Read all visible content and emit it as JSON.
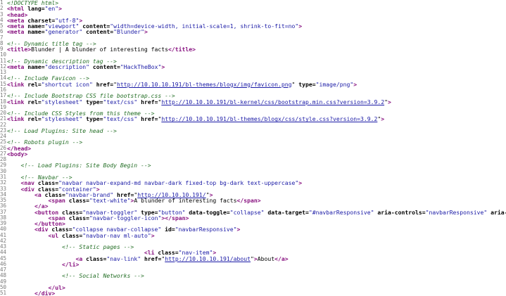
{
  "source_lines": [
    {
      "n": "1",
      "indent": "",
      "tokens": [
        {
          "t": "c",
          "v": "<!DOCTYPE html>"
        }
      ]
    },
    {
      "n": "2",
      "indent": "",
      "tokens": [
        {
          "t": "tag",
          "v": "<html"
        },
        {
          "t": "attr",
          "v": " lang="
        },
        {
          "t": "val",
          "v": "\"en\""
        },
        {
          "t": "tag",
          "v": ">"
        }
      ]
    },
    {
      "n": "3",
      "indent": "",
      "tokens": [
        {
          "t": "tag",
          "v": "<head>"
        }
      ]
    },
    {
      "n": "4",
      "indent": "",
      "tokens": [
        {
          "t": "tag",
          "v": "<meta"
        },
        {
          "t": "attr",
          "v": " charset="
        },
        {
          "t": "val",
          "v": "\"utf-8\""
        },
        {
          "t": "tag",
          "v": ">"
        }
      ]
    },
    {
      "n": "5",
      "indent": "",
      "tokens": [
        {
          "t": "tag",
          "v": "<meta"
        },
        {
          "t": "attr",
          "v": " name="
        },
        {
          "t": "val",
          "v": "\"viewport\""
        },
        {
          "t": "attr",
          "v": " content="
        },
        {
          "t": "val",
          "v": "\"width=device-width, initial-scale=1, shrink-to-fit=no\""
        },
        {
          "t": "tag",
          "v": ">"
        }
      ]
    },
    {
      "n": "6",
      "indent": "",
      "tokens": [
        {
          "t": "tag",
          "v": "<meta"
        },
        {
          "t": "attr",
          "v": " name="
        },
        {
          "t": "val",
          "v": "\"generator\""
        },
        {
          "t": "attr",
          "v": " content="
        },
        {
          "t": "val",
          "v": "\"Blunder\""
        },
        {
          "t": "tag",
          "v": ">"
        }
      ]
    },
    {
      "n": "7",
      "indent": "",
      "tokens": []
    },
    {
      "n": "8",
      "indent": "",
      "tokens": [
        {
          "t": "c",
          "v": "<!-- Dynamic title tag -->"
        }
      ]
    },
    {
      "n": "9",
      "indent": "",
      "tokens": [
        {
          "t": "tag",
          "v": "<title>"
        },
        {
          "t": "txt",
          "v": "Blunder | A blunder of interesting facts"
        },
        {
          "t": "tag",
          "v": "</title>"
        }
      ]
    },
    {
      "n": "10",
      "indent": "",
      "tokens": []
    },
    {
      "n": "11",
      "indent": "",
      "tokens": [
        {
          "t": "c",
          "v": "<!-- Dynamic description tag -->"
        }
      ]
    },
    {
      "n": "12",
      "indent": "",
      "tokens": [
        {
          "t": "tag",
          "v": "<meta"
        },
        {
          "t": "attr",
          "v": " name="
        },
        {
          "t": "val",
          "v": "\"description\""
        },
        {
          "t": "attr",
          "v": " content="
        },
        {
          "t": "val",
          "v": "\"HackTheBox\""
        },
        {
          "t": "tag",
          "v": ">"
        }
      ]
    },
    {
      "n": "13",
      "indent": "",
      "tokens": []
    },
    {
      "n": "14",
      "indent": "",
      "tokens": [
        {
          "t": "c",
          "v": "<!-- Include Favicon -->"
        }
      ]
    },
    {
      "n": "15",
      "indent": "",
      "tokens": [
        {
          "t": "tag",
          "v": "<link"
        },
        {
          "t": "attr",
          "v": " rel="
        },
        {
          "t": "val",
          "v": "\"shortcut icon\""
        },
        {
          "t": "attr",
          "v": " href="
        },
        {
          "t": "txt",
          "v": "\""
        },
        {
          "t": "link",
          "v": "http://10.10.10.191/bl-themes/blogx/img/favicon.png"
        },
        {
          "t": "txt",
          "v": "\""
        },
        {
          "t": "attr",
          "v": " type="
        },
        {
          "t": "val",
          "v": "\"image/png\""
        },
        {
          "t": "tag",
          "v": ">"
        }
      ]
    },
    {
      "n": "16",
      "indent": "",
      "tokens": []
    },
    {
      "n": "17",
      "indent": "",
      "tokens": [
        {
          "t": "c",
          "v": "<!-- Include Bootstrap CSS file bootstrap.css -->"
        }
      ]
    },
    {
      "n": "18",
      "indent": "",
      "tokens": [
        {
          "t": "tag",
          "v": "<link"
        },
        {
          "t": "attr",
          "v": " rel="
        },
        {
          "t": "val",
          "v": "\"stylesheet\""
        },
        {
          "t": "attr",
          "v": " type="
        },
        {
          "t": "val",
          "v": "\"text/css\""
        },
        {
          "t": "attr",
          "v": " href="
        },
        {
          "t": "txt",
          "v": "\""
        },
        {
          "t": "link",
          "v": "http://10.10.10.191/bl-kernel/css/bootstrap.min.css?version=3.9.2"
        },
        {
          "t": "txt",
          "v": "\""
        },
        {
          "t": "tag",
          "v": ">"
        }
      ]
    },
    {
      "n": "19",
      "indent": "",
      "tokens": []
    },
    {
      "n": "20",
      "indent": "",
      "tokens": [
        {
          "t": "c",
          "v": "<!-- Include CSS Styles from this theme -->"
        }
      ]
    },
    {
      "n": "21",
      "indent": "",
      "tokens": [
        {
          "t": "tag",
          "v": "<link"
        },
        {
          "t": "attr",
          "v": " rel="
        },
        {
          "t": "val",
          "v": "\"stylesheet\""
        },
        {
          "t": "attr",
          "v": " type="
        },
        {
          "t": "val",
          "v": "\"text/css\""
        },
        {
          "t": "attr",
          "v": " href="
        },
        {
          "t": "txt",
          "v": "\""
        },
        {
          "t": "link",
          "v": "http://10.10.10.191/bl-themes/blogx/css/style.css?version=3.9.2"
        },
        {
          "t": "txt",
          "v": "\""
        },
        {
          "t": "tag",
          "v": ">"
        }
      ]
    },
    {
      "n": "22",
      "indent": "",
      "tokens": []
    },
    {
      "n": "23",
      "indent": "",
      "tokens": [
        {
          "t": "c",
          "v": "<!-- Load Plugins: Site head -->"
        }
      ]
    },
    {
      "n": "24",
      "indent": "",
      "tokens": []
    },
    {
      "n": "25",
      "indent": "",
      "tokens": [
        {
          "t": "c",
          "v": "<!-- Robots plugin -->"
        }
      ]
    },
    {
      "n": "26",
      "indent": "",
      "tokens": [
        {
          "t": "tag",
          "v": "</head>"
        }
      ]
    },
    {
      "n": "27",
      "indent": "",
      "tokens": [
        {
          "t": "tag",
          "v": "<body>"
        }
      ]
    },
    {
      "n": "28",
      "indent": "",
      "tokens": []
    },
    {
      "n": "29",
      "indent": "    ",
      "tokens": [
        {
          "t": "c",
          "v": "<!-- Load Plugins: Site Body Begin -->"
        }
      ]
    },
    {
      "n": "30",
      "indent": "",
      "tokens": []
    },
    {
      "n": "31",
      "indent": "    ",
      "tokens": [
        {
          "t": "c",
          "v": "<!-- Navbar -->"
        }
      ]
    },
    {
      "n": "32",
      "indent": "    ",
      "tokens": [
        {
          "t": "tag",
          "v": "<nav"
        },
        {
          "t": "attr",
          "v": " class="
        },
        {
          "t": "val",
          "v": "\"navbar navbar-expand-md navbar-dark fixed-top bg-dark text-uppercase\""
        },
        {
          "t": "tag",
          "v": ">"
        }
      ]
    },
    {
      "n": "33",
      "indent": "    ",
      "tokens": [
        {
          "t": "tag",
          "v": "<div"
        },
        {
          "t": "attr",
          "v": " class="
        },
        {
          "t": "val",
          "v": "\"container\""
        },
        {
          "t": "tag",
          "v": ">"
        }
      ]
    },
    {
      "n": "34",
      "indent": "        ",
      "tokens": [
        {
          "t": "tag",
          "v": "<a"
        },
        {
          "t": "attr",
          "v": " class="
        },
        {
          "t": "val",
          "v": "\"navbar-brand\""
        },
        {
          "t": "attr",
          "v": " href="
        },
        {
          "t": "txt",
          "v": "\""
        },
        {
          "t": "link",
          "v": "http://10.10.10.191/"
        },
        {
          "t": "txt",
          "v": "\""
        },
        {
          "t": "tag",
          "v": ">"
        }
      ]
    },
    {
      "n": "35",
      "indent": "            ",
      "tokens": [
        {
          "t": "tag",
          "v": "<span"
        },
        {
          "t": "attr",
          "v": " class="
        },
        {
          "t": "val",
          "v": "\"text-white\""
        },
        {
          "t": "tag",
          "v": ">"
        },
        {
          "t": "txt",
          "v": "A blunder of interesting facts"
        },
        {
          "t": "tag",
          "v": "</span>"
        }
      ]
    },
    {
      "n": "36",
      "indent": "        ",
      "tokens": [
        {
          "t": "tag",
          "v": "</a>"
        }
      ]
    },
    {
      "n": "37",
      "indent": "        ",
      "tokens": [
        {
          "t": "tag",
          "v": "<button"
        },
        {
          "t": "attr",
          "v": " class="
        },
        {
          "t": "val",
          "v": "\"navbar-toggler\""
        },
        {
          "t": "attr",
          "v": " type="
        },
        {
          "t": "val",
          "v": "\"button\""
        },
        {
          "t": "attr",
          "v": " data-toggle="
        },
        {
          "t": "val",
          "v": "\"collapse\""
        },
        {
          "t": "attr",
          "v": " data-target="
        },
        {
          "t": "val",
          "v": "\"#navbarResponsive\""
        },
        {
          "t": "attr",
          "v": " aria-controls="
        },
        {
          "t": "val",
          "v": "\"navbarResponsive\""
        },
        {
          "t": "attr",
          "v": " aria-e"
        }
      ]
    },
    {
      "n": "38",
      "indent": "            ",
      "tokens": [
        {
          "t": "tag",
          "v": "<span"
        },
        {
          "t": "attr",
          "v": " class="
        },
        {
          "t": "val",
          "v": "\"navbar-toggler-icon\""
        },
        {
          "t": "tag",
          "v": "></span>"
        }
      ]
    },
    {
      "n": "39",
      "indent": "        ",
      "tokens": [
        {
          "t": "tag",
          "v": "</button>"
        }
      ]
    },
    {
      "n": "40",
      "indent": "        ",
      "tokens": [
        {
          "t": "tag",
          "v": "<div"
        },
        {
          "t": "attr",
          "v": " class="
        },
        {
          "t": "val",
          "v": "\"collapse navbar-collapse\""
        },
        {
          "t": "attr",
          "v": " id="
        },
        {
          "t": "val",
          "v": "\"navbarResponsive\""
        },
        {
          "t": "tag",
          "v": ">"
        }
      ]
    },
    {
      "n": "41",
      "indent": "            ",
      "tokens": [
        {
          "t": "tag",
          "v": "<ul"
        },
        {
          "t": "attr",
          "v": " class="
        },
        {
          "t": "val",
          "v": "\"navbar-nav ml-auto\""
        },
        {
          "t": "tag",
          "v": ">"
        }
      ]
    },
    {
      "n": "42",
      "indent": "",
      "tokens": []
    },
    {
      "n": "43",
      "indent": "                ",
      "tokens": [
        {
          "t": "c",
          "v": "<!-- Static pages -->"
        }
      ]
    },
    {
      "n": "44",
      "indent": "                                        ",
      "tokens": [
        {
          "t": "tag",
          "v": "<li"
        },
        {
          "t": "attr",
          "v": " class="
        },
        {
          "t": "val",
          "v": "\"nav-item\""
        },
        {
          "t": "tag",
          "v": ">"
        }
      ]
    },
    {
      "n": "45",
      "indent": "                    ",
      "tokens": [
        {
          "t": "tag",
          "v": "<a"
        },
        {
          "t": "attr",
          "v": " class="
        },
        {
          "t": "val",
          "v": "\"nav-link\""
        },
        {
          "t": "attr",
          "v": " href="
        },
        {
          "t": "txt",
          "v": "\""
        },
        {
          "t": "link",
          "v": "http://10.10.10.191/about"
        },
        {
          "t": "txt",
          "v": "\""
        },
        {
          "t": "tag",
          "v": ">"
        },
        {
          "t": "txt",
          "v": "About"
        },
        {
          "t": "tag",
          "v": "</a>"
        }
      ]
    },
    {
      "n": "46",
      "indent": "                ",
      "tokens": [
        {
          "t": "tag",
          "v": "</li>"
        }
      ]
    },
    {
      "n": "47",
      "indent": "",
      "tokens": []
    },
    {
      "n": "48",
      "indent": "                ",
      "tokens": [
        {
          "t": "c",
          "v": "<!-- Social Networks -->"
        }
      ]
    },
    {
      "n": "49",
      "indent": "",
      "tokens": []
    },
    {
      "n": "50",
      "indent": "            ",
      "tokens": [
        {
          "t": "tag",
          "v": "</ul>"
        }
      ]
    },
    {
      "n": "51",
      "indent": "        ",
      "tokens": [
        {
          "t": "tag",
          "v": "</div>"
        }
      ]
    }
  ]
}
